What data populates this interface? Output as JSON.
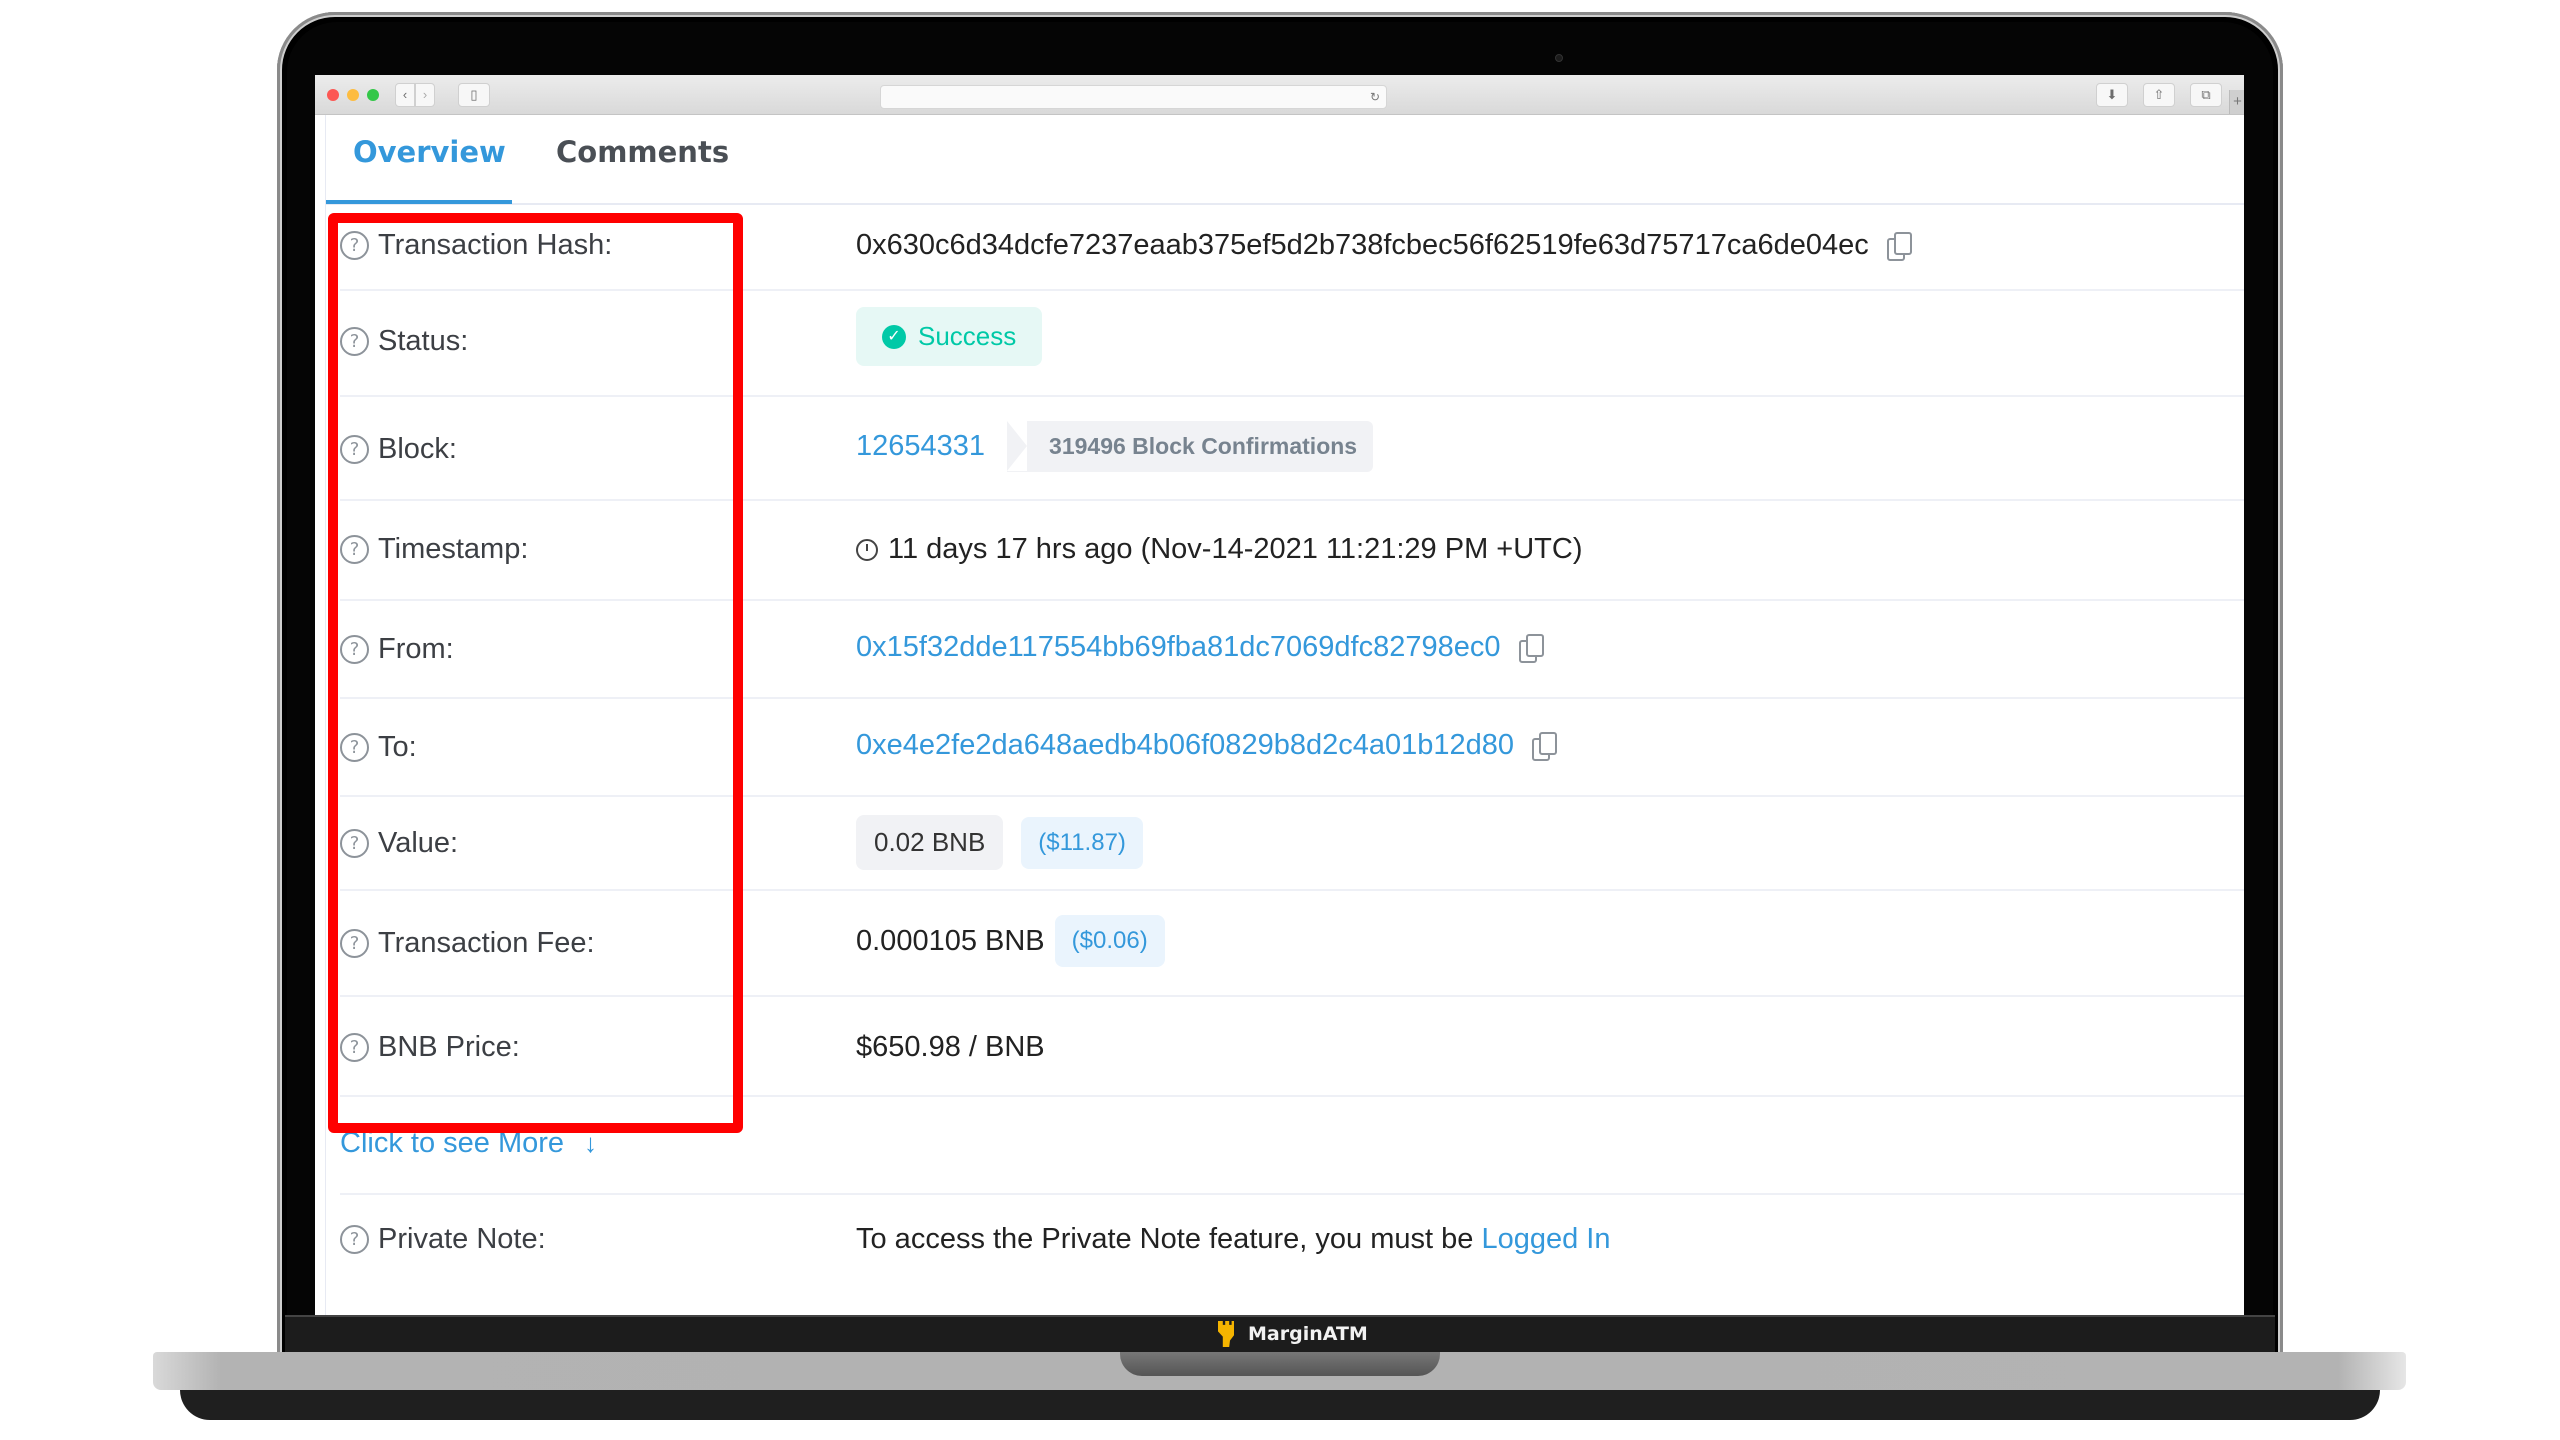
{
  "browser": {
    "back_icon": "‹",
    "forward_icon": "›",
    "sidebar_icon": "▯",
    "reload_icon": "↻",
    "download_icon": "⬇",
    "share_icon": "⇧",
    "tabs_icon": "⧉",
    "new_tab_icon": "+",
    "address": ""
  },
  "tabs": [
    {
      "label": "Overview",
      "active": true
    },
    {
      "label": "Comments",
      "active": false
    }
  ],
  "rows": {
    "tx_hash": {
      "label": "Transaction Hash:",
      "value": "0x630c6d34dcfe7237eaab375ef5d2b738fcbec56f62519fe63d75717ca6de04ec"
    },
    "status": {
      "label": "Status:",
      "value": "Success",
      "check_icon": "✓"
    },
    "block": {
      "label": "Block:",
      "value": "12654331",
      "confirmations": "319496 Block Confirmations"
    },
    "timestamp": {
      "label": "Timestamp:",
      "value": "11 days 17 hrs ago (Nov-14-2021 11:21:29 PM +UTC)"
    },
    "from": {
      "label": "From:",
      "value": "0x15f32dde117554bb69fba81dc7069dfc82798ec0"
    },
    "to": {
      "label": "To:",
      "value": "0xe4e2fe2da648aedb4b06f0829b8d2c4a01b12d80"
    },
    "value": {
      "label": "Value:",
      "amount": "0.02 BNB",
      "usd": "($11.87)"
    },
    "fee": {
      "label": "Transaction Fee:",
      "amount": "0.000105 BNB",
      "usd": "($0.06)"
    },
    "price": {
      "label": "BNB Price:",
      "value": "$650.98 / BNB"
    }
  },
  "more_link": {
    "label": "Click to see More",
    "icon": "↓"
  },
  "private_note": {
    "label": "Private Note:",
    "text": "To access the Private Note feature, you must be ",
    "link": "Logged In"
  },
  "help_icon": "?",
  "brand": {
    "name": "MarginATM"
  },
  "colors": {
    "accent": "#3498db",
    "success": "#00c9a7",
    "highlight": "#ff0000"
  }
}
